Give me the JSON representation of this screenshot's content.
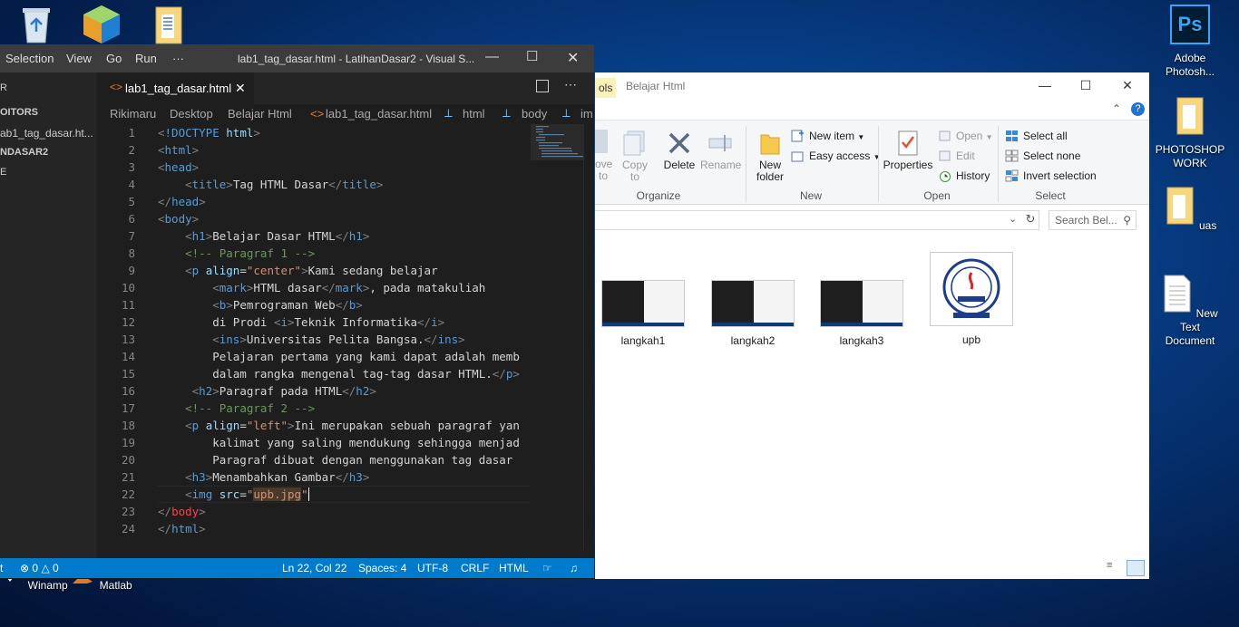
{
  "desktop": {
    "icons_left": [
      {
        "name": "recycle-bin",
        "label": ""
      },
      {
        "name": "app-cube",
        "label": ""
      },
      {
        "name": "document-folder",
        "label": ""
      }
    ],
    "icons_right": [
      {
        "label": "Adobe Photosh..."
      },
      {
        "label": "PHOTOSHOP WORK"
      },
      {
        "label": "uas"
      },
      {
        "label": "New Text Document"
      }
    ],
    "taskbar_icons": [
      {
        "label": "Winamp"
      },
      {
        "label": "Matlab"
      }
    ],
    "ps_logo_text": "Ps"
  },
  "explorer": {
    "tools_tab": "ols",
    "title": "Belajar Html",
    "ribbon": {
      "move_to": "ove\nto",
      "copy_to": "Copy\nto",
      "delete": "Delete",
      "rename": "Rename",
      "new_folder": "New\nfolder",
      "new_item": "New item",
      "easy_access": "Easy access",
      "properties": "Properties",
      "open": "Open",
      "edit": "Edit",
      "history": "History",
      "select_all": "Select all",
      "select_none": "Select none",
      "invert_selection": "Invert selection",
      "groups": {
        "organize": "Organize",
        "new": "New",
        "open": "Open",
        "select": "Select"
      }
    },
    "search_placeholder": "Search Bel...",
    "files": [
      {
        "label": "langkah1"
      },
      {
        "label": "langkah2"
      },
      {
        "label": "langkah3"
      },
      {
        "label": "upb"
      }
    ]
  },
  "vscode": {
    "menu": [
      "Selection",
      "View",
      "Go",
      "Run",
      "···"
    ],
    "title": "lab1_tag_dasar.html - LatihanDasar2 - Visual S...",
    "sidebar": {
      "header": "R",
      "open_editors": "OITORS",
      "open_file": "ab1_tag_dasar.ht...",
      "workspace": "NDASAR2",
      "item": "E"
    },
    "tab_label": "lab1_tag_dasar.html",
    "breadcrumb": [
      "Rikimaru",
      "Desktop",
      "Belajar Html",
      "lab1_tag_dasar.html",
      "html",
      "body",
      "im"
    ],
    "code_lines": [
      "1",
      "2",
      "3",
      "4",
      "5",
      "6",
      "7",
      "8",
      "9",
      "10",
      "11",
      "12",
      "13",
      "14",
      "15",
      "16",
      "17",
      "18",
      "19",
      "20",
      "21",
      "22",
      "23",
      "24"
    ],
    "status": {
      "remote": "t",
      "errors": "0",
      "warnings": "0",
      "position": "Ln 22, Col 22",
      "spaces": "Spaces: 4",
      "encoding": "UTF-8",
      "eol": "CRLF",
      "language": "HTML"
    }
  }
}
